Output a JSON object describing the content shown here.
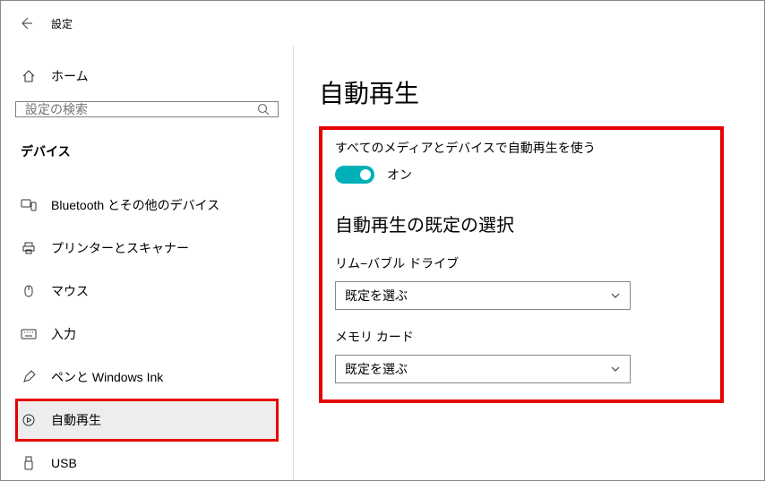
{
  "header": {
    "title": "設定"
  },
  "sidebar": {
    "home": "ホーム",
    "search_placeholder": "設定の検索",
    "group": "デバイス",
    "items": [
      {
        "label": "Bluetooth とその他のデバイス"
      },
      {
        "label": "プリンターとスキャナー"
      },
      {
        "label": "マウス"
      },
      {
        "label": "入力"
      },
      {
        "label": "ペンと Windows Ink"
      },
      {
        "label": "自動再生"
      },
      {
        "label": "USB"
      }
    ]
  },
  "main": {
    "page_title": "自動再生",
    "use_all_label": "すべてのメディアとデバイスで自動再生を使う",
    "toggle_state": "オン",
    "defaults_heading": "自動再生の既定の選択",
    "section1": {
      "label": "リム−バブル ドライブ",
      "value": "既定を選ぶ"
    },
    "section2": {
      "label": "メモリ カード",
      "value": "既定を選ぶ"
    }
  }
}
